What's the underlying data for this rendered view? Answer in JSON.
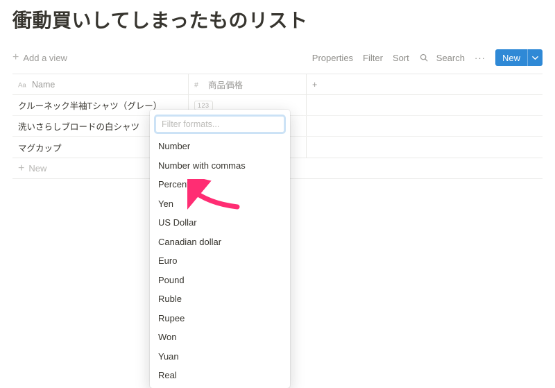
{
  "title": "衝動買いしてしまったものリスト",
  "toolbar": {
    "add_view": "Add a view",
    "properties": "Properties",
    "filter": "Filter",
    "sort": "Sort",
    "search": "Search",
    "more": "···",
    "new": "New"
  },
  "columns": {
    "name": "Name",
    "price": "商品価格"
  },
  "rows": [
    {
      "name": "クルーネック半袖Tシャツ（グレー）"
    },
    {
      "name": "洗いさらしブロードの白シャツ"
    },
    {
      "name": "マグカップ"
    }
  ],
  "new_row": "New",
  "format_popup": {
    "placeholder": "Filter formats...",
    "options": [
      "Number",
      "Number with commas",
      "Percent",
      "Yen",
      "US Dollar",
      "Canadian dollar",
      "Euro",
      "Pound",
      "Ruble",
      "Rupee",
      "Won",
      "Yuan",
      "Real"
    ]
  },
  "badge": "123"
}
